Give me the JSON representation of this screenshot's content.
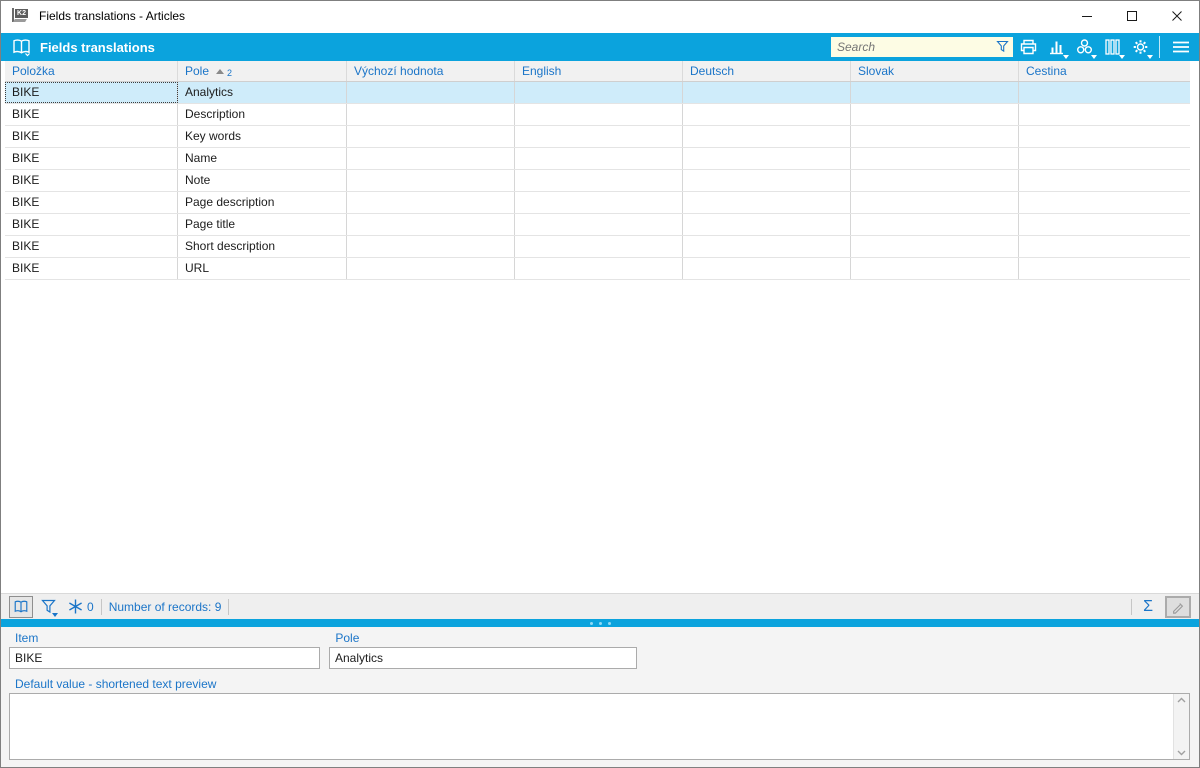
{
  "window": {
    "title": "Fields translations - Articles",
    "app_icon_text": "K2"
  },
  "app_bar": {
    "title": "Fields translations",
    "search": {
      "placeholder": "Search",
      "value": ""
    }
  },
  "table": {
    "columns": [
      "Položka",
      "Pole",
      "Výchozí hodnota",
      "English",
      "Deutsch",
      "Slovak",
      "Cestina"
    ],
    "sort": {
      "column": "Pole",
      "direction": "asc",
      "order": "2"
    },
    "selected_row_index": 0,
    "rows": [
      {
        "item": "BIKE",
        "field": "Analytics",
        "default_value": "",
        "english": "",
        "deutsch": "",
        "slovak": "",
        "cestina": ""
      },
      {
        "item": "BIKE",
        "field": "Description",
        "default_value": "",
        "english": "",
        "deutsch": "",
        "slovak": "",
        "cestina": ""
      },
      {
        "item": "BIKE",
        "field": "Key words",
        "default_value": "",
        "english": "",
        "deutsch": "",
        "slovak": "",
        "cestina": ""
      },
      {
        "item": "BIKE",
        "field": "Name",
        "default_value": "",
        "english": "",
        "deutsch": "",
        "slovak": "",
        "cestina": ""
      },
      {
        "item": "BIKE",
        "field": "Note",
        "default_value": "",
        "english": "",
        "deutsch": "",
        "slovak": "",
        "cestina": ""
      },
      {
        "item": "BIKE",
        "field": "Page description",
        "default_value": "",
        "english": "",
        "deutsch": "",
        "slovak": "",
        "cestina": ""
      },
      {
        "item": "BIKE",
        "field": "Page title",
        "default_value": "",
        "english": "",
        "deutsch": "",
        "slovak": "",
        "cestina": ""
      },
      {
        "item": "BIKE",
        "field": "Short description",
        "default_value": "",
        "english": "",
        "deutsch": "",
        "slovak": "",
        "cestina": ""
      },
      {
        "item": "BIKE",
        "field": "URL",
        "default_value": "",
        "english": "",
        "deutsch": "",
        "slovak": "",
        "cestina": ""
      }
    ]
  },
  "status_bar": {
    "counter": "0",
    "records": "Number of records: 9",
    "sigma": "Σ"
  },
  "detail": {
    "item_label": "Item",
    "item_value": "BIKE",
    "field_label": "Pole",
    "field_value": "Analytics",
    "preview_label": "Default value - shortened text preview",
    "preview_value": ""
  },
  "colors": {
    "accent": "#0ba3dd",
    "header_text": "#1b75c8",
    "selected_row": "#cfecfa",
    "search_bg": "#fdfce4"
  }
}
